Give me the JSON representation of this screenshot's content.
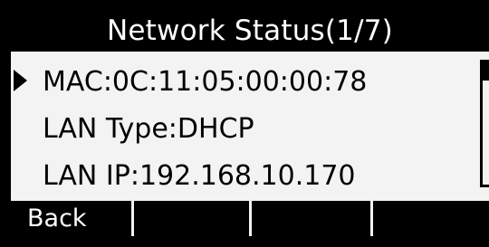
{
  "header": {
    "title": "Network Status(1/7)"
  },
  "list": {
    "items": [
      {
        "label": "MAC:0C:11:05:00:00:78",
        "selected": true
      },
      {
        "label": "LAN Type:DHCP",
        "selected": false
      },
      {
        "label": "LAN IP:192.168.10.170",
        "selected": false
      }
    ]
  },
  "softkeys": {
    "key1": "Back",
    "key2": "",
    "key3": "",
    "key4": ""
  },
  "colors": {
    "screen_background": "#f3f3f3",
    "bar_background": "#000000",
    "bar_text": "#ffffff",
    "text": "#000000"
  }
}
